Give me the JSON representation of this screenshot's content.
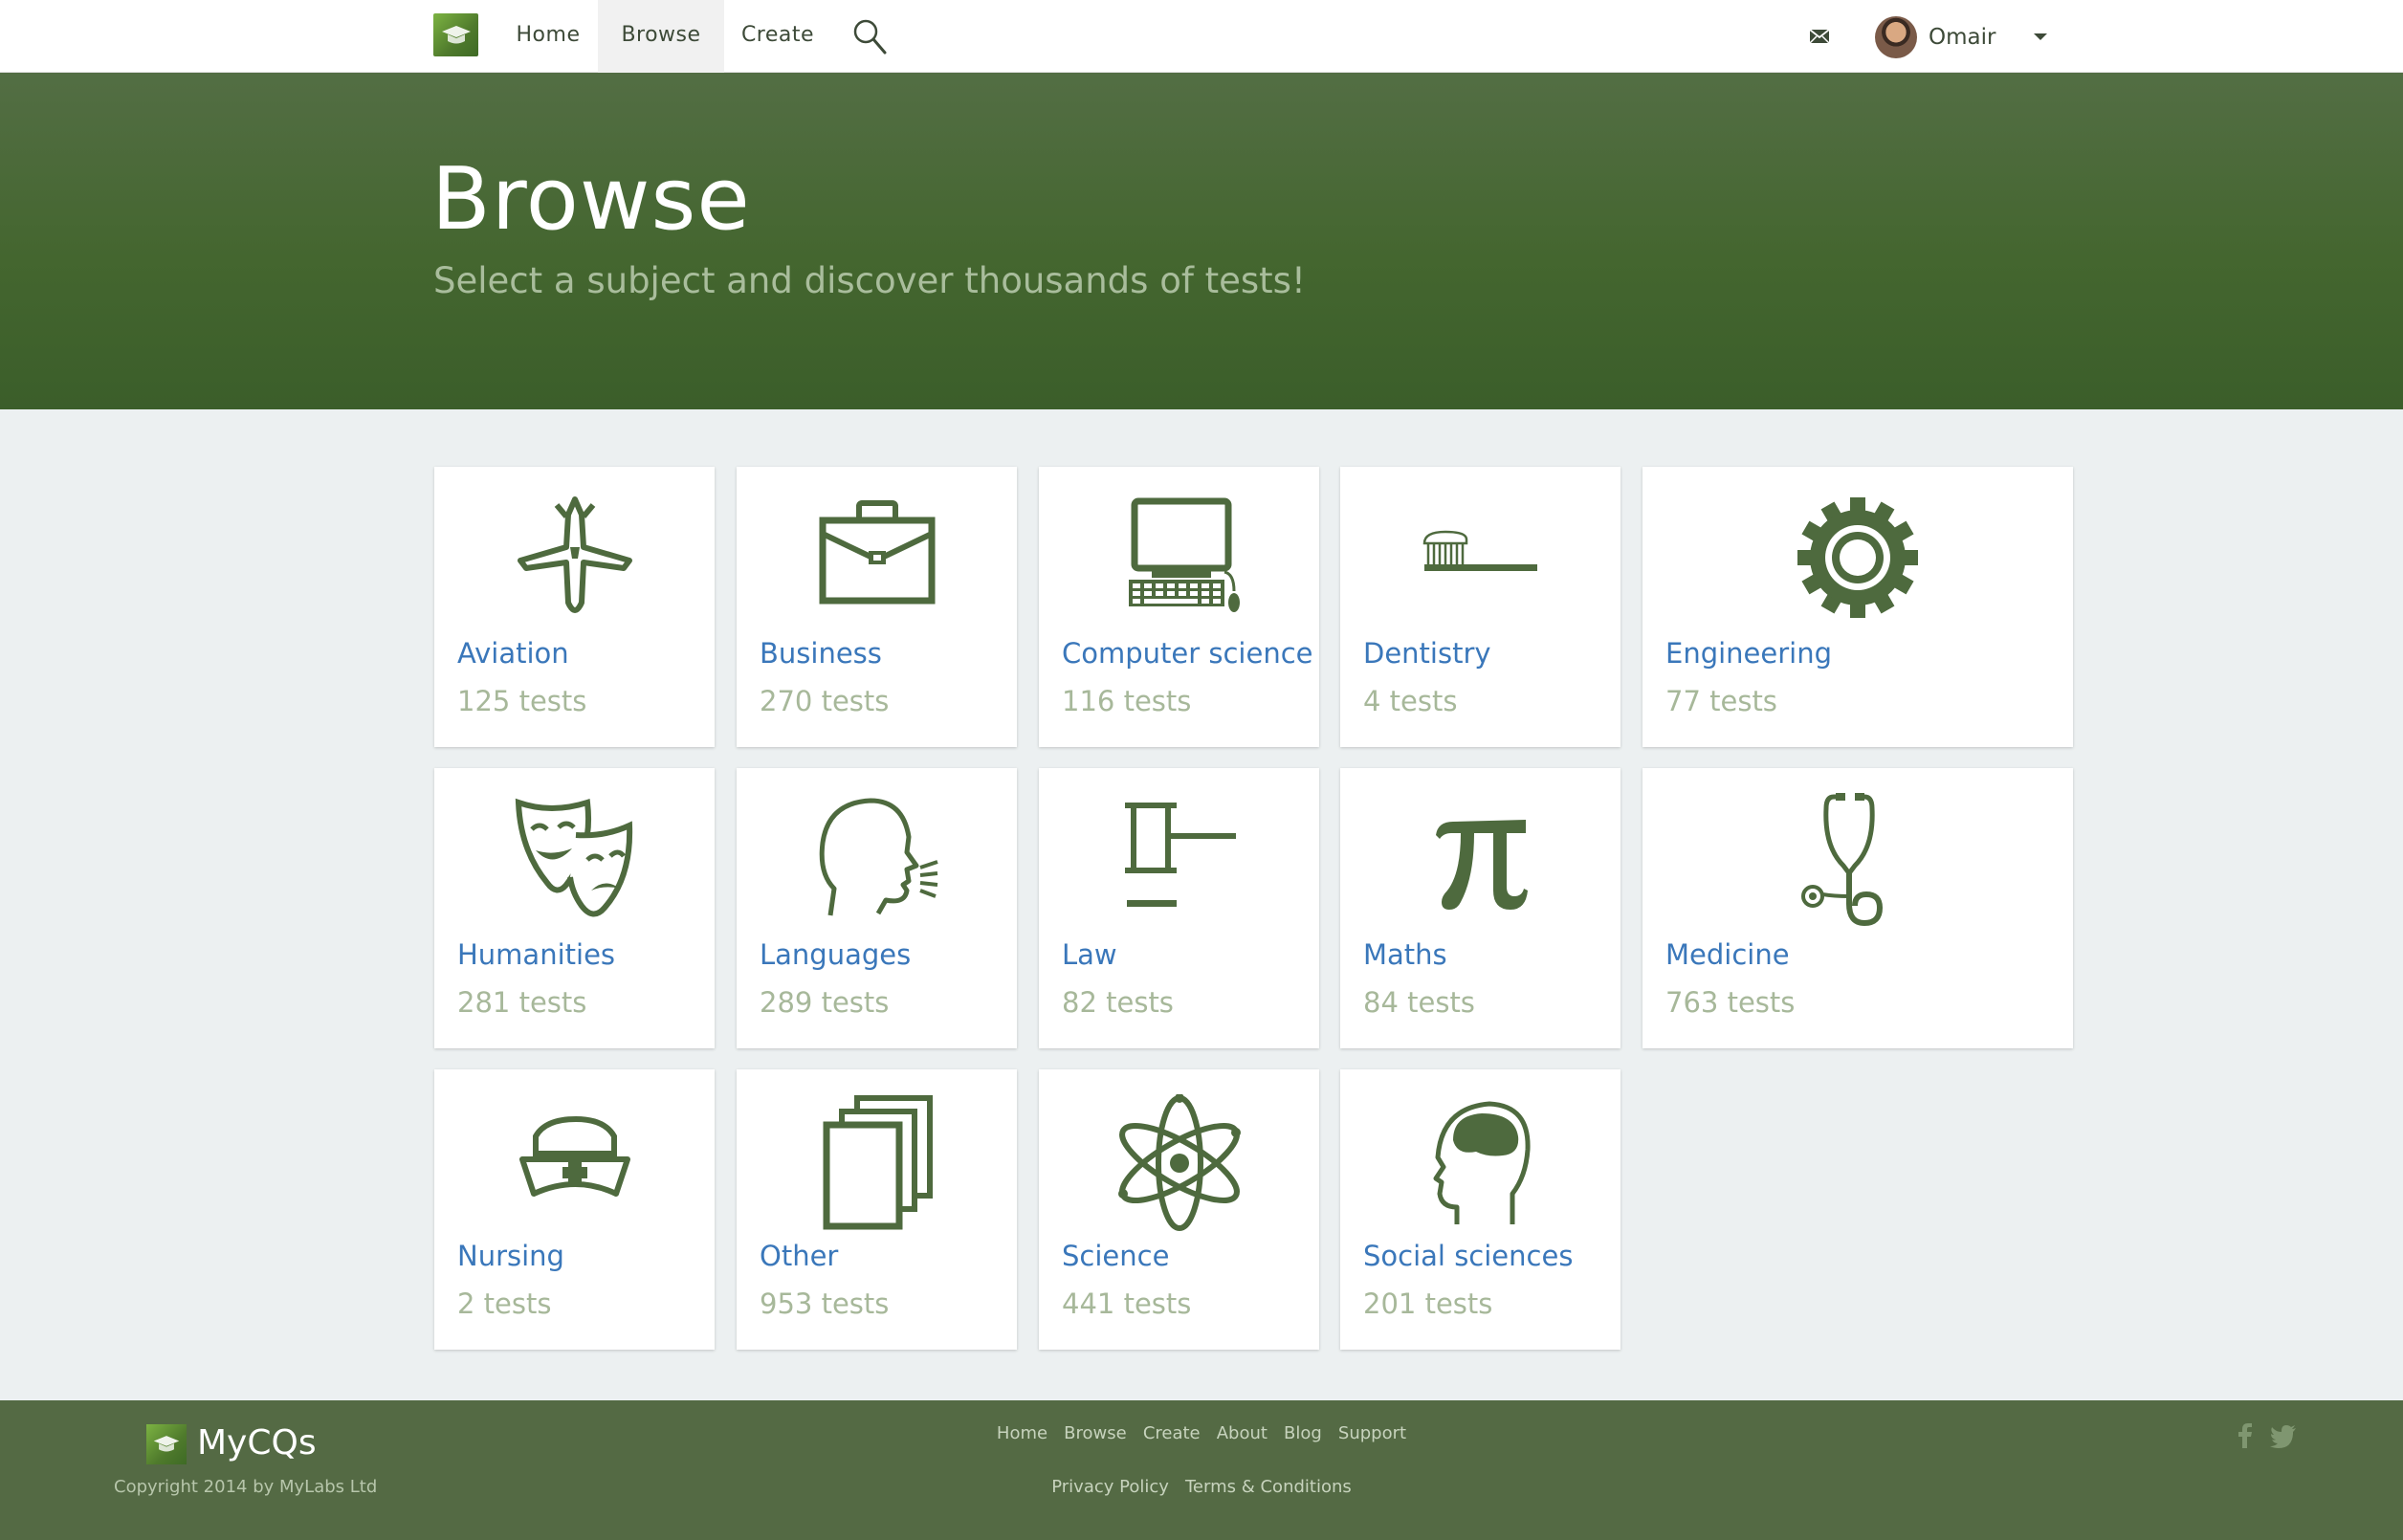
{
  "nav": {
    "home": "Home",
    "browse": "Browse",
    "create": "Create",
    "user": "Omair"
  },
  "hero": {
    "title": "Browse",
    "subtitle": "Select a subject and discover thousands of tests!"
  },
  "subjects": [
    {
      "name": "Aviation",
      "count": "125 tests",
      "icon": "airplane-icon"
    },
    {
      "name": "Business",
      "count": "270 tests",
      "icon": "briefcase-icon"
    },
    {
      "name": "Computer science",
      "count": "116 tests",
      "icon": "computer-icon"
    },
    {
      "name": "Dentistry",
      "count": "4 tests",
      "icon": "toothbrush-icon"
    },
    {
      "name": "Engineering",
      "count": "77 tests",
      "icon": "gear-icon"
    },
    {
      "name": "Humanities",
      "count": "281 tests",
      "icon": "theater-masks-icon"
    },
    {
      "name": "Languages",
      "count": "289 tests",
      "icon": "speaking-head-icon"
    },
    {
      "name": "Law",
      "count": "82 tests",
      "icon": "gavel-icon"
    },
    {
      "name": "Maths",
      "count": "84 tests",
      "icon": "pi-icon"
    },
    {
      "name": "Medicine",
      "count": "763 tests",
      "icon": "stethoscope-icon"
    },
    {
      "name": "Nursing",
      "count": "2 tests",
      "icon": "nurse-cap-icon"
    },
    {
      "name": "Other",
      "count": "953 tests",
      "icon": "documents-icon"
    },
    {
      "name": "Science",
      "count": "441 tests",
      "icon": "atom-icon"
    },
    {
      "name": "Social sciences",
      "count": "201 tests",
      "icon": "brain-head-icon"
    }
  ],
  "footer": {
    "brand": "MyCQs",
    "copyright": "Copyright 2014 by MyLabs Ltd",
    "links": [
      "Home",
      "Browse",
      "Create",
      "About",
      "Blog",
      "Support"
    ],
    "legal": [
      "Privacy Policy",
      "Terms & Conditions"
    ]
  },
  "colors": {
    "brand_green": "#44662f",
    "icon_green": "#4e6a3e",
    "link_blue": "#3a77ba",
    "count_gray": "#a7b89a"
  }
}
